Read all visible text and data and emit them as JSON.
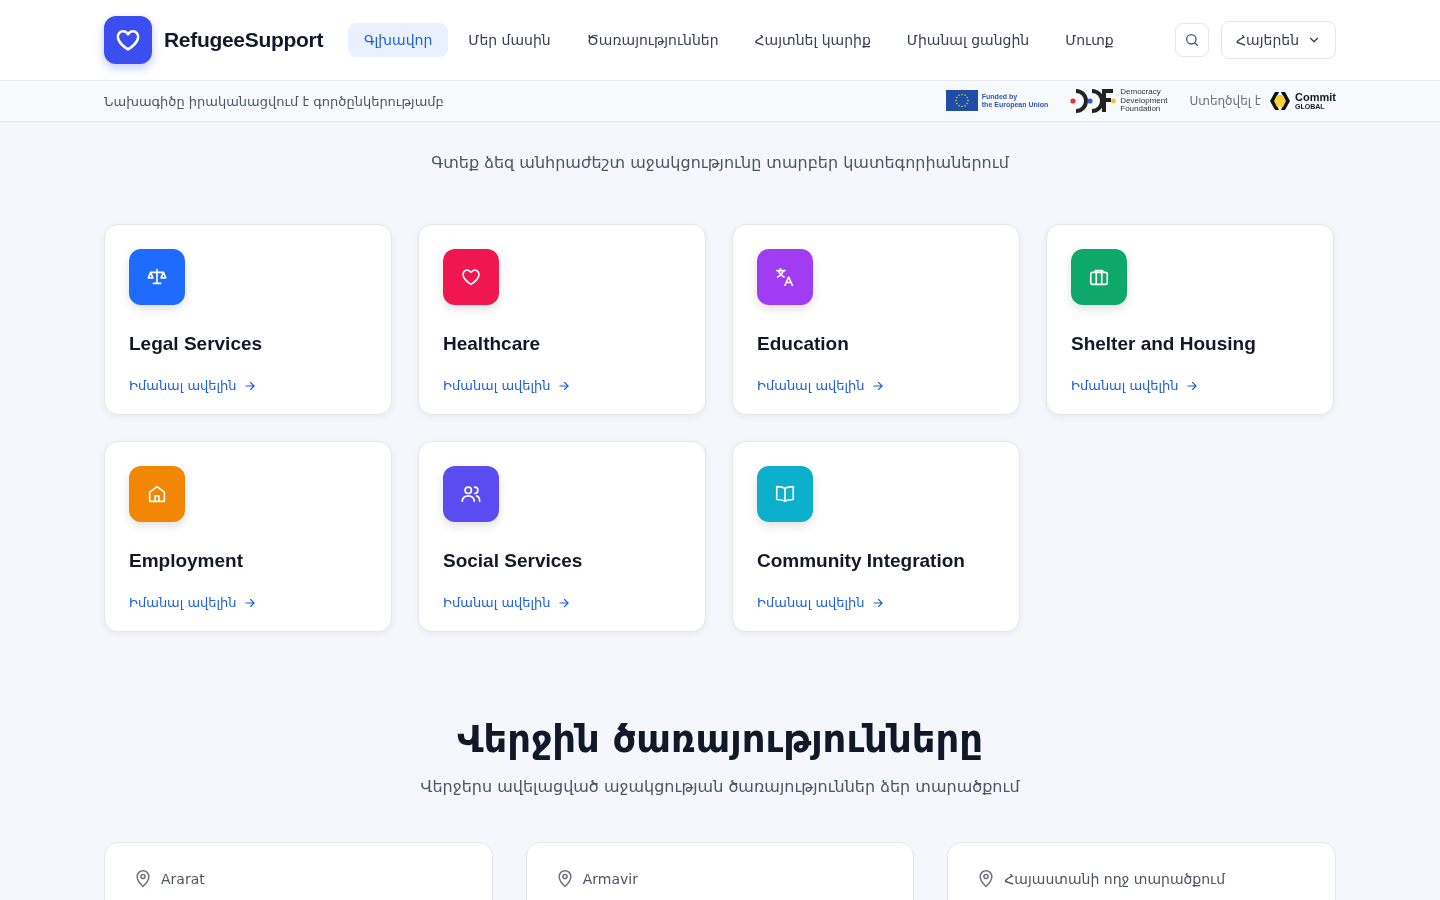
{
  "brand": {
    "name": "RefugeeSupport"
  },
  "nav": [
    {
      "label": "Գլխավոր",
      "selected": true
    },
    {
      "label": "Մեր մասին",
      "selected": false
    },
    {
      "label": "Ծառայություններ",
      "selected": false
    },
    {
      "label": "Հայտնել կարիք",
      "selected": false
    },
    {
      "label": "Միանալ ցանցին",
      "selected": false
    },
    {
      "label": "Մուտք",
      "selected": false
    }
  ],
  "language": "Հայերեն",
  "partner_bar": {
    "text": "Նախագիծը իրականացվում է գործընկերությամբ",
    "eu": {
      "line1": "Funded by",
      "line2": "the European Union"
    },
    "ddf": [
      "Democracy",
      "Development",
      "Foundation"
    ],
    "created_by": "Ստեղծվել է",
    "commit": {
      "name": "Commit",
      "sub": "GLOBAL"
    }
  },
  "categories_section": {
    "subtitle": "Գտեք ձեզ անհրաժեշտ աջակցությունը տարբեր կատեգորիաներում",
    "cards": [
      {
        "title": "Legal Services",
        "link": "Իմանալ ավելին",
        "color": "#1f6bff"
      },
      {
        "title": "Healthcare",
        "link": "Իմանալ ավելին",
        "color": "#f0164f"
      },
      {
        "title": "Education",
        "link": "Իմանալ ավելին",
        "color": "#a23cf2"
      },
      {
        "title": "Shelter and Housing",
        "link": "Իմանալ ավելին",
        "color": "#0ea86a"
      },
      {
        "title": "Employment",
        "link": "Իմանալ ավելին",
        "color": "#f28705"
      },
      {
        "title": "Social Services",
        "link": "Իմանալ ավելին",
        "color": "#5a4cf0"
      },
      {
        "title": "Community Integration",
        "link": "Իմանալ ավելին",
        "color": "#0cb0cc"
      }
    ]
  },
  "latest_section": {
    "title": "Վերջին ծառայությունները",
    "subtitle": "Վերջերս ավելացված աջակցության ծառայություններ ձեր տարածքում",
    "cards": [
      {
        "location": "Ararat"
      },
      {
        "location": "Armavir"
      },
      {
        "location": "Հայաստանի ողջ տարածքում"
      }
    ]
  }
}
